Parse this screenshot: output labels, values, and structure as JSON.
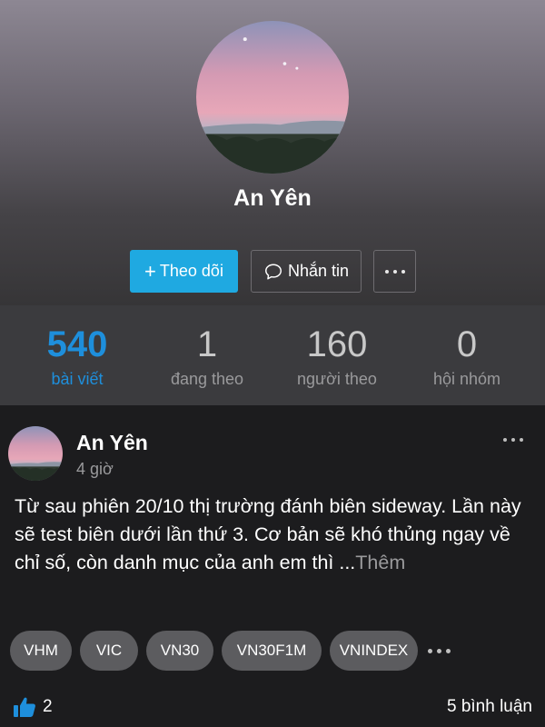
{
  "profile": {
    "name": "An Yên",
    "follow_label": "Theo dõi",
    "message_label": "Nhắn tin"
  },
  "stats": [
    {
      "value": "540",
      "label": "bài viết",
      "active": true
    },
    {
      "value": "1",
      "label": "đang theo",
      "active": false
    },
    {
      "value": "160",
      "label": "người theo",
      "active": false
    },
    {
      "value": "0",
      "label": "hội nhóm",
      "active": false
    }
  ],
  "post": {
    "author": "An Yên",
    "time": "4 giờ",
    "text": "Từ sau phiên 20/10 thị trường đánh biên sideway. Lần này sẽ test biên dưới lần thứ 3. Cơ bản sẽ khó thủng ngay về chỉ số, còn danh mục của anh em thì ...",
    "more_label": "Thêm",
    "tags": [
      "VHM",
      "VIC",
      "VN30",
      "VN30F1M",
      "VNINDEX"
    ],
    "likes": "2",
    "comments": "5 bình luận"
  },
  "colors": {
    "accent": "#1fa9e1",
    "active_stat": "#1e8fdc"
  },
  "icons": [
    "plus-icon",
    "chat-bubble-icon",
    "more-dots-icon",
    "thumbs-up-icon"
  ]
}
